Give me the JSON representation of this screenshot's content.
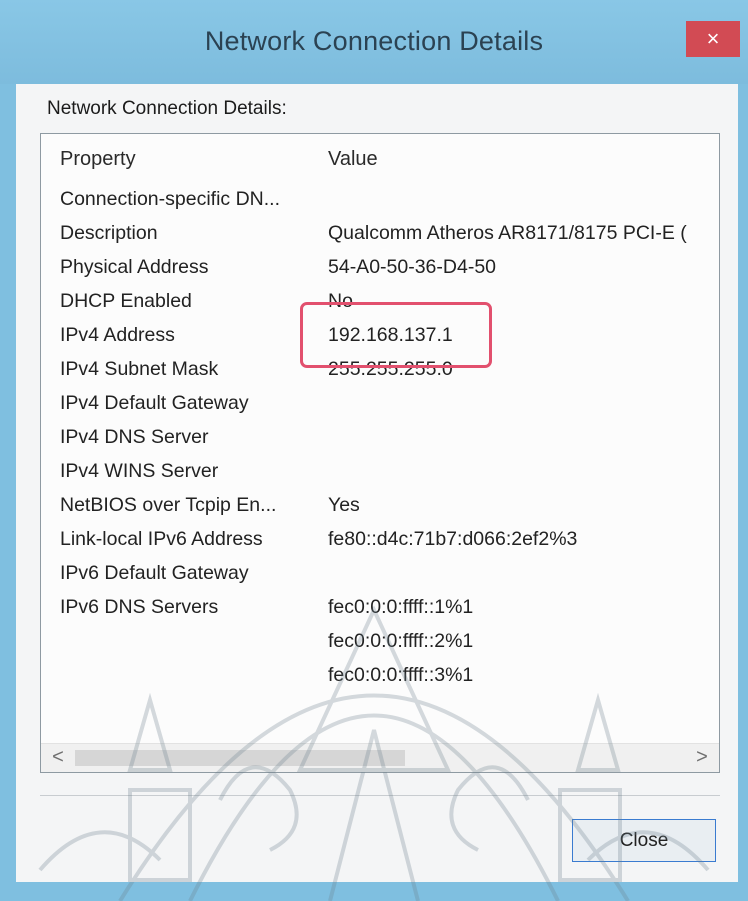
{
  "window": {
    "title": "Network Connection Details",
    "close_glyph": "×"
  },
  "dialog": {
    "group_label": "Network Connection Details:",
    "columns": {
      "property": "Property",
      "value": "Value"
    },
    "rows": [
      {
        "property": "Connection-specific DN...",
        "value": ""
      },
      {
        "property": "Description",
        "value": "Qualcomm Atheros AR8171/8175 PCI-E ("
      },
      {
        "property": "Physical Address",
        "value": "54-A0-50-36-D4-50"
      },
      {
        "property": "DHCP Enabled",
        "value": "No"
      },
      {
        "property": "IPv4 Address",
        "value": "192.168.137.1"
      },
      {
        "property": "IPv4 Subnet Mask",
        "value": "255.255.255.0"
      },
      {
        "property": "IPv4 Default Gateway",
        "value": ""
      },
      {
        "property": "IPv4 DNS Server",
        "value": ""
      },
      {
        "property": "IPv4 WINS Server",
        "value": ""
      },
      {
        "property": "NetBIOS over Tcpip En...",
        "value": "Yes"
      },
      {
        "property": "Link-local IPv6 Address",
        "value": "fe80::d4c:71b7:d066:2ef2%3"
      },
      {
        "property": "IPv6 Default Gateway",
        "value": ""
      },
      {
        "property": "IPv6 DNS Servers",
        "value": "fec0:0:0:ffff::1%1"
      },
      {
        "property": "",
        "value": "fec0:0:0:ffff::2%1"
      },
      {
        "property": "",
        "value": "fec0:0:0:ffff::3%1"
      }
    ],
    "scroll_left_glyph": "<",
    "scroll_right_glyph": ">",
    "close_label": "Close"
  },
  "colors": {
    "title_bar": "#7dbcdd",
    "close_x": "#d24b54",
    "highlight": "#e2506e",
    "button_border": "#3a7bd0"
  },
  "icons": [
    "close-icon",
    "scroll-left-icon",
    "scroll-right-icon"
  ]
}
